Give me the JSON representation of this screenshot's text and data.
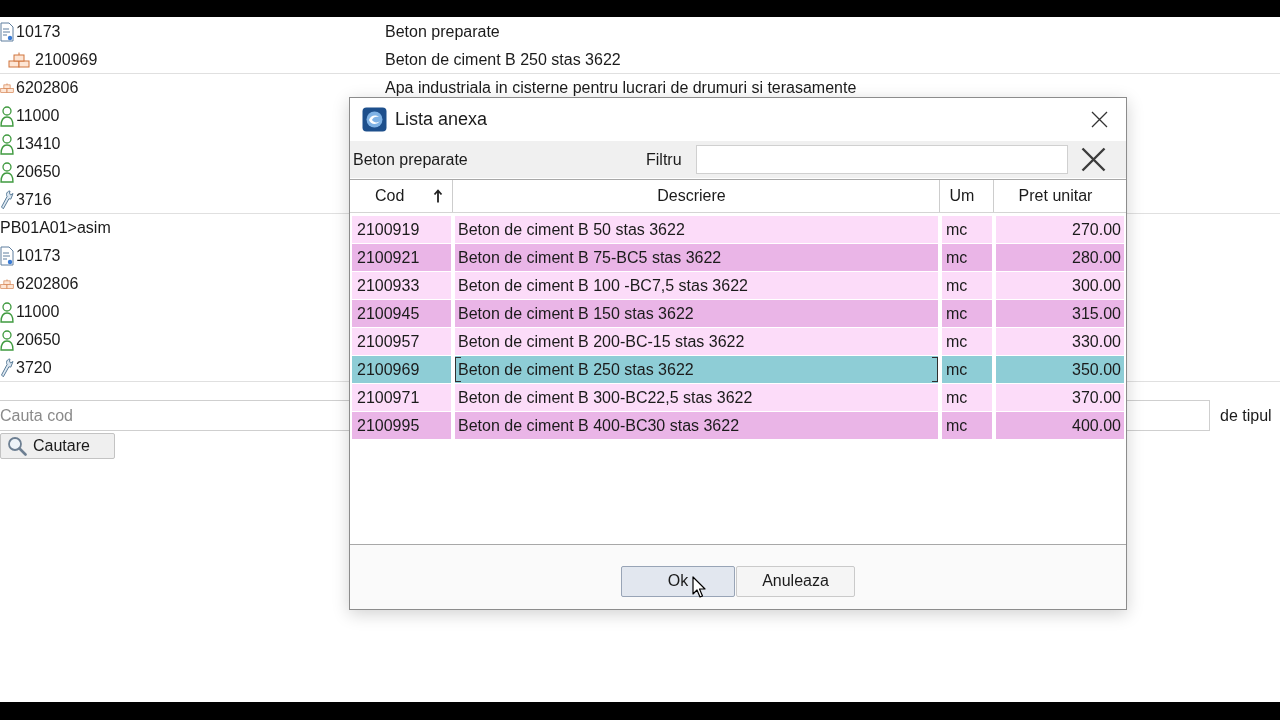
{
  "tree": [
    {
      "children": [
        {
          "kind": "document",
          "code": "10173",
          "description": "Beton preparate",
          "children": [
            {
              "kind": "material",
              "code": "2100969",
              "description": "Beton de ciment B 250 stas 3622"
            }
          ]
        },
        {
          "kind": "material",
          "code": "6202806",
          "description": "Apa industriala in cisterne pentru lucrari de drumuri si terasamente"
        },
        {
          "kind": "worker",
          "code": "11000"
        },
        {
          "kind": "worker",
          "code": "13410"
        },
        {
          "kind": "worker",
          "code": "20650"
        },
        {
          "kind": "tool",
          "code": "3716"
        }
      ]
    },
    {
      "code": "PB01A01>asim",
      "children": [
        {
          "kind": "document",
          "code": "10173"
        },
        {
          "kind": "material",
          "code": "6202806"
        },
        {
          "kind": "worker",
          "code": "11000"
        },
        {
          "kind": "worker",
          "code": "20650"
        },
        {
          "kind": "tool",
          "code": "3720"
        }
      ]
    }
  ],
  "search": {
    "placeholder": "Cauta cod",
    "type_label": "de tipul",
    "button": "Cautare"
  },
  "dialog": {
    "title": "Lista anexa",
    "category": "Beton preparate",
    "filter_label": "Filtru",
    "columns": [
      {
        "label": "Cod",
        "sorted": true
      },
      {
        "label": "Descriere",
        "sorted": false
      },
      {
        "label": "Um",
        "sorted": false
      },
      {
        "label": "Pret unitar",
        "sorted": false
      }
    ],
    "rows": [
      {
        "cells": [
          "2100919",
          "Beton de ciment B 50 stas 3622",
          "mc",
          "270.00"
        ],
        "selected": false
      },
      {
        "cells": [
          "2100921",
          "Beton de ciment B 75-BC5 stas 3622",
          "mc",
          "280.00"
        ],
        "selected": false
      },
      {
        "cells": [
          "2100933",
          "Beton de ciment B 100 -BC7,5 stas 3622",
          "mc",
          "300.00"
        ],
        "selected": false
      },
      {
        "cells": [
          "2100945",
          "Beton de ciment B 150 stas 3622",
          "mc",
          "315.00"
        ],
        "selected": false
      },
      {
        "cells": [
          "2100957",
          "Beton de ciment B 200-BC-15 stas 3622",
          "mc",
          "330.00"
        ],
        "selected": false
      },
      {
        "cells": [
          "2100969",
          "Beton de ciment B 250 stas 3622",
          "mc",
          "350.00"
        ],
        "selected": true
      },
      {
        "cells": [
          "2100971",
          "Beton de ciment B 300-BC22,5 stas 3622",
          "mc",
          "370.00"
        ],
        "selected": false
      },
      {
        "cells": [
          "2100995",
          "Beton de ciment B 400-BC30 stas 3622",
          "mc",
          "400.00"
        ],
        "selected": false
      }
    ],
    "buttons": [
      {
        "label": "Ok",
        "focused": true
      },
      {
        "label": "Anuleaza",
        "focused": false
      }
    ]
  }
}
